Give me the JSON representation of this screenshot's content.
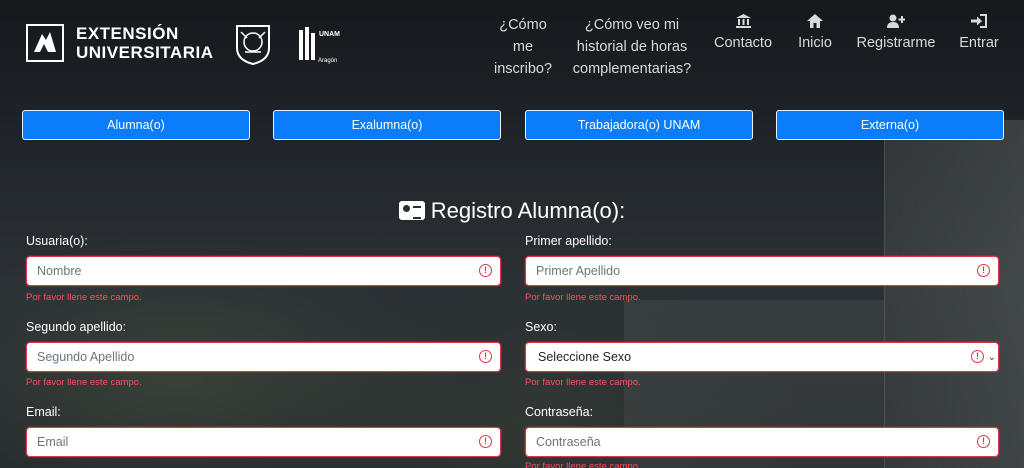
{
  "header": {
    "logo_line1": "EXTENSIÓN",
    "logo_line2": "UNIVERSITARIA",
    "seal2_text": "UNAM",
    "seal2_sub": "Aragón",
    "nav": [
      {
        "label": "¿Cómo me inscribo?",
        "icon": ""
      },
      {
        "label": "¿Cómo veo mi historial de horas complementarias?",
        "icon": ""
      },
      {
        "label": "Contacto",
        "icon": "bank-icon"
      },
      {
        "label": "Inicio",
        "icon": "home-icon"
      },
      {
        "label": "Registrarme",
        "icon": "user-plus-icon"
      },
      {
        "label": "Entrar",
        "icon": "sign-in-icon"
      }
    ]
  },
  "tabs": [
    "Alumna(o)",
    "Exalumna(o)",
    "Trabajadora(o) UNAM",
    "Externa(o)"
  ],
  "form": {
    "title": "Registro Alumna(o):",
    "error_text": "Por favor llene este campo.",
    "fields": [
      {
        "label": "Usuaria(o):",
        "placeholder": "Nombre"
      },
      {
        "label": "Primer apellido:",
        "placeholder": "Primer Apellido"
      },
      {
        "label": "Segundo apellido:",
        "placeholder": "Segundo Apellido"
      },
      {
        "label": "Sexo:",
        "value": "Seleccione Sexo"
      },
      {
        "label": "Email:",
        "placeholder": "Email"
      },
      {
        "label": "Contraseña:",
        "placeholder": "Contraseña"
      }
    ]
  },
  "colors": {
    "accent": "#0b7dfa",
    "error": "#dc3545"
  }
}
